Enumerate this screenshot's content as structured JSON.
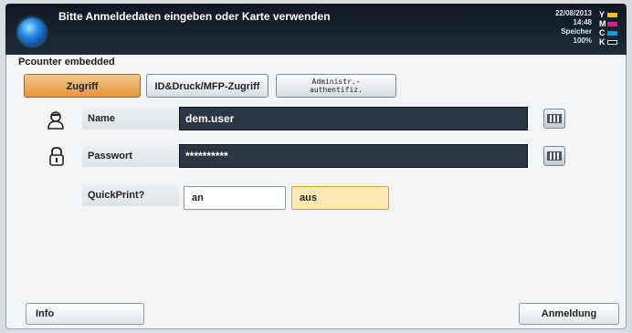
{
  "header": {
    "title": "Bitte Anmeldedaten eingeben oder Karte verwenden",
    "date": "22/08/2013",
    "time": "14:48",
    "memory_label": "Speicher",
    "memory_value": "100%",
    "toner": [
      {
        "letter": "Y",
        "color": "#f2c500"
      },
      {
        "letter": "M",
        "color": "#d1218a"
      },
      {
        "letter": "C",
        "color": "#00a0e3"
      },
      {
        "letter": "K",
        "color": "#111111"
      }
    ]
  },
  "section_label": "Pcounter embedded",
  "tabs": [
    {
      "label": "Zugriff",
      "active": true
    },
    {
      "label": "ID&Druck/MFP-Zugriff",
      "active": false
    },
    {
      "label_line1": "Administr.-",
      "label_line2": "authentifiz.",
      "active": false
    }
  ],
  "form": {
    "name_label": "Name",
    "name_value": "dem.user",
    "password_label": "Passwort",
    "password_value": "**********",
    "quickprint_label": "QuickPrint?",
    "quickprint_on": "an",
    "quickprint_off": "aus",
    "quickprint_selected": "aus"
  },
  "footer": {
    "info_label": "Info",
    "login_label": "Anmeldung"
  },
  "icons": {
    "user": "user-icon",
    "lock": "lock-icon",
    "keyboard": "keyboard-icon"
  }
}
